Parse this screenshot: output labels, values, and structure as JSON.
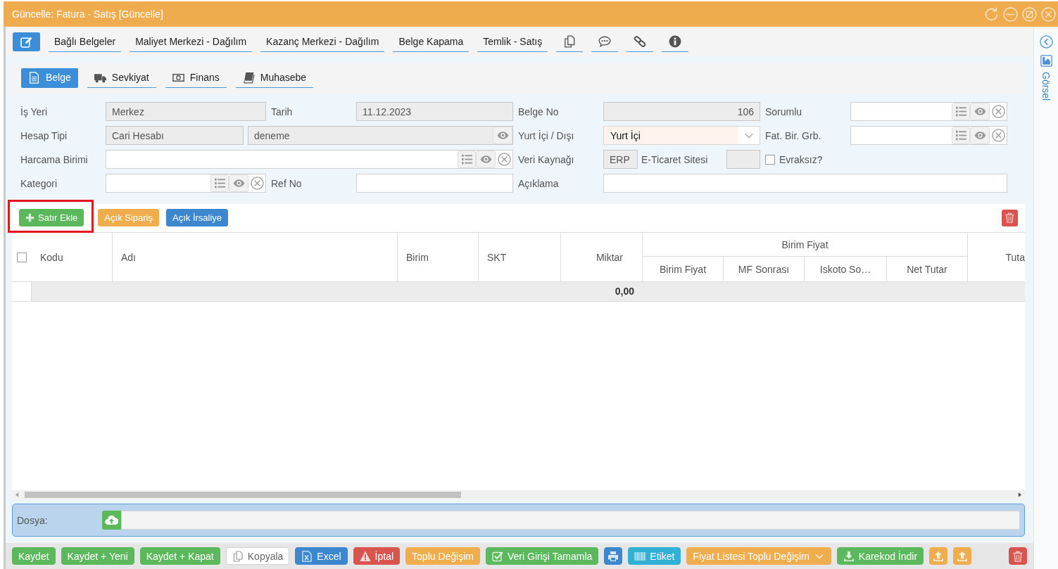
{
  "window": {
    "title": "Güncelle: Fatura - Satış [Güncelle]"
  },
  "toolbar": {
    "links": [
      "Bağlı Belgeler",
      "Maliyet Merkezi - Dağılım",
      "Kazanç Merkezi - Dağılım",
      "Belge Kapama",
      "Temlik - Satış"
    ]
  },
  "side_panel": {
    "label": "Görsel"
  },
  "tabs": [
    {
      "label": "Belge",
      "selected": true
    },
    {
      "label": "Sevkiyat",
      "selected": false
    },
    {
      "label": "Finans",
      "selected": false
    },
    {
      "label": "Muhasebe",
      "selected": false
    }
  ],
  "form": {
    "workplace": {
      "label": "İş Yeri",
      "value": "Merkez",
      "readonly": true
    },
    "date": {
      "label": "Tarih",
      "value": "11.12.2023",
      "readonly": true
    },
    "document_no": {
      "label": "Belge No",
      "value": "106",
      "readonly": true
    },
    "responsible": {
      "label": "Sorumlu",
      "readonly": false
    },
    "account_type": {
      "label": "Hesap Tipi",
      "value": "Cari Hesabı",
      "readonly": true
    },
    "account": {
      "value": "deneme",
      "readonly": true
    },
    "domestic_foreign": {
      "label": "Yurt İçi / Dışı",
      "value": "Yurt İçi"
    },
    "invoice_group": {
      "label": "Fat. Bir. Grb.",
      "readonly": false
    },
    "spending_unit": {
      "label": "Harcama Birimi",
      "readonly": false
    },
    "data_source": {
      "label": "Veri Kaynağı",
      "value": "ERP",
      "readonly": true
    },
    "ecommerce_site": {
      "label": "E-Ticaret Sitesi",
      "readonly": true
    },
    "paperless": {
      "label": "Evraksız?",
      "checked": false
    },
    "category": {
      "label": "Kategori",
      "readonly": false
    },
    "ref_no": {
      "label": "Ref No",
      "readonly": false
    },
    "description": {
      "label": "Açıklama",
      "readonly": false
    }
  },
  "line_actions": [
    {
      "kind": "add",
      "label": "Satır Ekle",
      "color": "#5cb85c",
      "highlighted": true
    },
    {
      "kind": "plain",
      "label": "Açık Sipariş",
      "color": "#f0ad4e",
      "highlighted": false
    },
    {
      "kind": "plain",
      "label": "Açık İrsaliye",
      "color": "#3c87cd",
      "highlighted": false
    }
  ],
  "table": {
    "select_all": {
      "checked": false
    },
    "columns": [
      {
        "label": "Kodu"
      },
      {
        "label": "Adı"
      },
      {
        "label": "Birim"
      },
      {
        "label": "SKT"
      },
      {
        "label": "Miktar"
      },
      {
        "label": "Birim Fiyat",
        "children": [
          {
            "label": "Birim Fiyat"
          },
          {
            "label": "MF Sonrası"
          },
          {
            "label": "Iskoto So…"
          },
          {
            "label": "Net Tutar"
          }
        ]
      },
      {
        "label": "Tuta"
      }
    ],
    "total_row": {
      "quantity": "0,00"
    }
  },
  "attachment": {
    "label": "Dosya:"
  },
  "footer_actions": [
    {
      "kind": "plain",
      "label": "Kaydet",
      "color": "#5cb85c",
      "disabled": false
    },
    {
      "kind": "plain",
      "label": "Kaydet + Yeni",
      "color": "#5cb85c",
      "disabled": false
    },
    {
      "kind": "plain",
      "label": "Kaydet + Kapat",
      "color": "#5cb85c",
      "disabled": false
    },
    {
      "kind": "copy",
      "label": "Kopyala",
      "disabled": true
    },
    {
      "kind": "excel",
      "label": "Excel",
      "color": "#3c87cd",
      "disabled": false
    },
    {
      "kind": "warning",
      "label": "İptal",
      "color": "#d9534f",
      "disabled": false
    },
    {
      "kind": "plain",
      "label": "Toplu Değişim",
      "color": "#f0ad4e",
      "disabled": false
    },
    {
      "kind": "check",
      "label": "Veri Girişi Tamamla",
      "color": "#5cb85c",
      "disabled": false
    },
    {
      "kind": "print",
      "color": "#3c87cd",
      "disabled": false
    },
    {
      "kind": "barcode",
      "label": "Etiket",
      "color": "#31b0d5",
      "disabled": false
    },
    {
      "kind": "dropdown",
      "label": "Fiyat Listesi Toplu Değişim",
      "color": "#f0ad4e",
      "disabled": false
    },
    {
      "kind": "download",
      "label": "Karekod İndir",
      "color": "#5cb85c",
      "disabled": false
    },
    {
      "kind": "upload",
      "color": "#f0ad4e",
      "disabled": false
    },
    {
      "kind": "upload",
      "color": "#f0ad4e",
      "disabled": false
    }
  ]
}
